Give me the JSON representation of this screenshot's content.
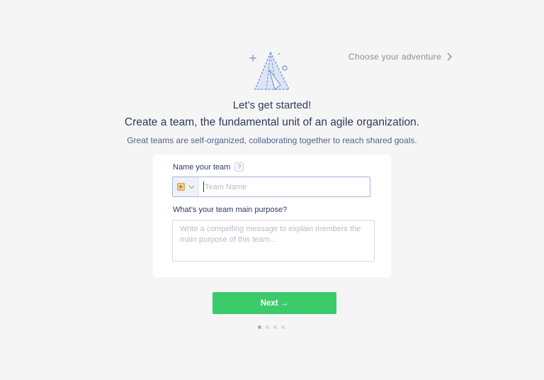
{
  "header": {
    "choose_link_label": "Choose your adventure"
  },
  "hero": {
    "icon": "tent-icon"
  },
  "intro": {
    "title": "Let’s get started!",
    "headline": "Create a team, the fundamental unit of an agile organization.",
    "subtitle": "Great teams are self-organized, collaborating together to reach shared goals."
  },
  "form": {
    "name_label": "Name your team",
    "help_glyph": "?",
    "name_placeholder": "Team Name",
    "name_value": "",
    "purpose_label": "What’s your team main purpose?",
    "purpose_placeholder": "Write a compelling message to explain members the main purpose of this team..."
  },
  "actions": {
    "next_label": "Next →"
  },
  "pagination": {
    "total_steps": 4,
    "current_step": 1
  },
  "colors": {
    "accent_green": "#3ccb6b",
    "text_navy": "#2d3a5c",
    "background": "#f5f5f6"
  }
}
